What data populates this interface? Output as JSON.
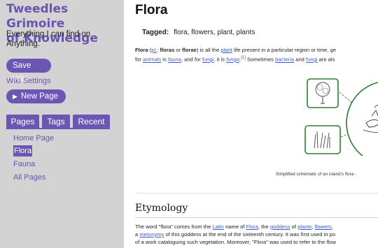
{
  "sidebar": {
    "title_line1": "Tweedles Grimoire",
    "title_line2": "of Knowledge",
    "subtitle": "Everything I can find on Anything.",
    "save_label": "Save Wiki",
    "settings_label": "Wiki Settings",
    "new_page_label": "New Page",
    "tabs": [
      "Pages",
      "Tags",
      "Recent"
    ],
    "pages": [
      "Home Page",
      "Flora",
      "Fauna",
      "All Pages"
    ]
  },
  "main": {
    "title": "Flora",
    "tagged_label": "Tagged:",
    "tags": "flora, flowers, plant, plants",
    "intro": {
      "l1": {
        "t1": "Flora",
        "t2": " (",
        "l_pl": "pl.",
        "t3": ": ",
        "t4": "floras",
        "t5": " or ",
        "t6": "florae",
        "t7": ") is all the ",
        "l_plant": "plant",
        "t8": " life present in a particular region or time, ge"
      },
      "l2": {
        "t1": "for ",
        "l_animals": "animals",
        "t2": " is ",
        "l_fauna": "fauna",
        "t3": ", and for ",
        "l_fungi": "fungi",
        "t4": ", it is ",
        "l_funga": "funga",
        "t5": ".",
        "sup": "[1]",
        "t6": " Sometimes ",
        "l_bacteria": "bacteria",
        "t7": " and ",
        "l_fungi2": "fungi",
        "t8": " are als"
      }
    },
    "caption": "Simplified schematic of an island's flora -",
    "section_title": "Etymology",
    "etym": {
      "l1": {
        "t1": "The word \"flora\" comes from the ",
        "l_latin": "Latin",
        "t2": " name of ",
        "l_flora": "Flora",
        "t3": ", the ",
        "l_goddess": "goddess",
        "t4": " of ",
        "l_plants": "plants",
        "t5": ", ",
        "l_flowers": "flowers",
        "t6": ","
      },
      "l2": {
        "t1": "a ",
        "l_metonymy": "metonymy",
        "t2": " of this goddess at the end of the sixteenth century. It was first used in po"
      },
      "l3": "of a work cataloguing such vegetation. Moreover, \"Flora\" was used to refer to the flow"
    }
  },
  "colors": {
    "accent": "#6c56b3",
    "sidebar_bg": "#d3d3d3",
    "link": "#3b5cc4",
    "figure_green": "#2e7d32"
  }
}
